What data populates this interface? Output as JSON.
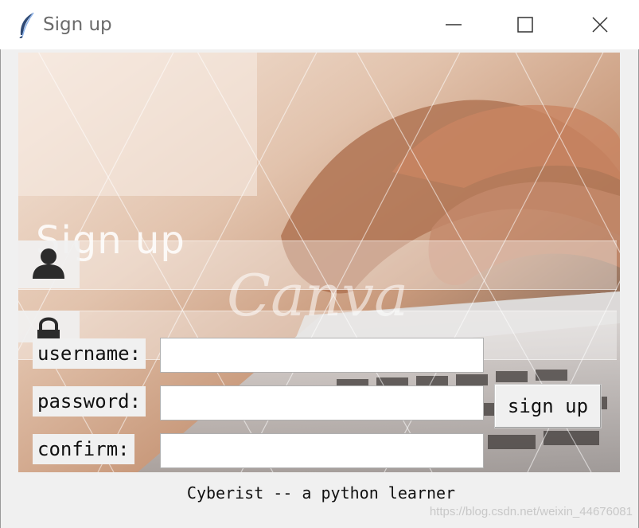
{
  "window": {
    "title": "Sign up",
    "icon": "feather-icon",
    "controls": [
      "minimize-icon",
      "maximize-icon",
      "close-icon"
    ]
  },
  "canvas": {
    "heading": "Sign up",
    "icons": [
      "user-icon",
      "lock-icon"
    ],
    "background_watermark": "Canva"
  },
  "form": {
    "username_label": "username:",
    "username_value": "",
    "password_label": "password:",
    "password_value": "",
    "confirm_label": "confirm:",
    "confirm_value": "",
    "signup_button": "sign up"
  },
  "footer": {
    "caption": "Cyberist -- a python learner",
    "watermark": "https://blog.csdn.net/weixin_44676081"
  },
  "colors": {
    "titlebar_bg": "#ffffff",
    "window_bg": "#f0f0f0",
    "entry_bg": "#ffffff"
  }
}
